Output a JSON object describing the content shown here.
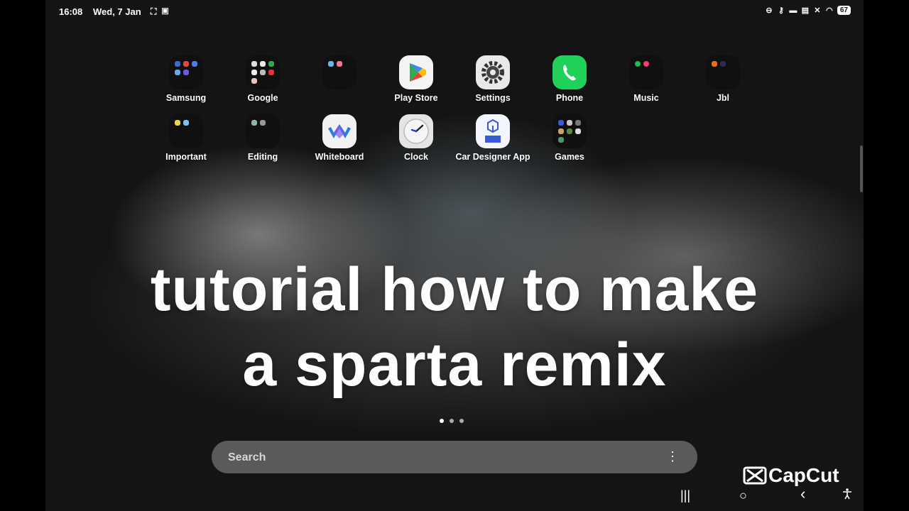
{
  "status_bar": {
    "time": "16:08",
    "date": "Wed, 7 Jan",
    "left_icons": [
      "screenshot-frame-icon",
      "screen-record-icon"
    ],
    "right_icons": [
      "do-not-disturb-icon",
      "key-icon",
      "car-icon",
      "cast-icon",
      "mute-icon",
      "wifi-icon"
    ],
    "battery": "67"
  },
  "apps": [
    {
      "label": "Samsung",
      "icon": "samsung-folder-icon"
    },
    {
      "label": "Google",
      "icon": "google-folder-icon"
    },
    {
      "label": "",
      "icon": "unnamed-folder-icon"
    },
    {
      "label": "Play Store",
      "icon": "play-store-icon"
    },
    {
      "label": "Settings",
      "icon": "settings-gear-icon"
    },
    {
      "label": "Phone",
      "icon": "phone-icon"
    },
    {
      "label": "Music",
      "icon": "music-folder-icon"
    },
    {
      "label": "Jbl",
      "icon": "jbl-folder-icon"
    },
    {
      "label": "Important",
      "icon": "important-folder-icon"
    },
    {
      "label": "Editing",
      "icon": "editing-folder-icon"
    },
    {
      "label": "Whiteboard",
      "icon": "whiteboard-icon"
    },
    {
      "label": "Clock",
      "icon": "clock-icon"
    },
    {
      "label": "Car Designer App",
      "icon": "car-designer-icon"
    },
    {
      "label": "Games",
      "icon": "games-folder-icon"
    }
  ],
  "overlay": {
    "line1": "tutorial how to make",
    "line2": "a sparta remix"
  },
  "page_indicator": {
    "pages": 3,
    "current": 1
  },
  "search": {
    "placeholder": "Search",
    "menu_glyph": "⋮"
  },
  "watermark": {
    "text": "CapCut"
  },
  "nav_bar": {
    "recents": "|||",
    "home": "○",
    "back": "‹",
    "accessibility": "accessibility-icon"
  },
  "colors": {
    "phone_green": "#1fd15a",
    "search_bg": "#5a5a5a",
    "folder_bg": "#0f0f0f"
  }
}
